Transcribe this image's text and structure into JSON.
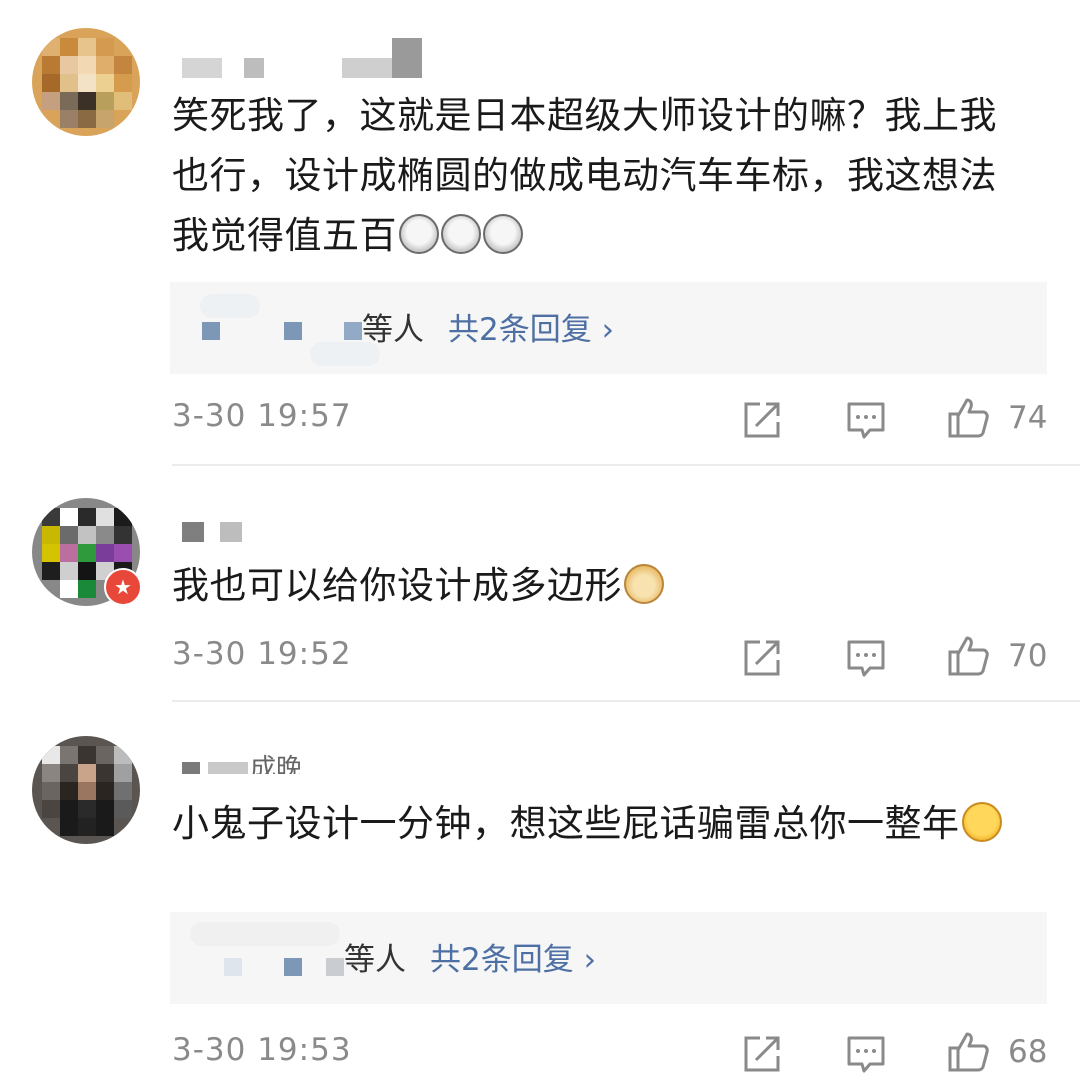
{
  "comments": [
    {
      "text": "笑死我了，这就是日本超级大师设计的嘛？我上我也行，设计成椭圆的做成电动汽车车标，我这想法我觉得值五百",
      "emojis": [
        "dizzy-face-emoji",
        "dizzy-face-emoji",
        "dizzy-face-emoji"
      ],
      "reply": {
        "partial_label": "等人",
        "link": "共2条回复 ›"
      },
      "time": "3-30 19:57",
      "likes": "74"
    },
    {
      "text": "我也可以给你设计成多边形",
      "emojis": [
        "doge-emoji"
      ],
      "time": "3-30 19:52",
      "likes": "70"
    },
    {
      "username_partial": "成晚",
      "text": "小鬼子设计一分钟，想这些屁话骗雷总你一整年",
      "emojis": [
        "crying-face-emoji"
      ],
      "reply": {
        "partial_label": "等人",
        "link": "共2条回复 ›"
      },
      "time": "3-30 19:53",
      "likes": "68"
    }
  ],
  "colors": {
    "link": "#4d6fa3",
    "meta": "#8a8a8a",
    "reply_bg": "#f6f6f6"
  }
}
